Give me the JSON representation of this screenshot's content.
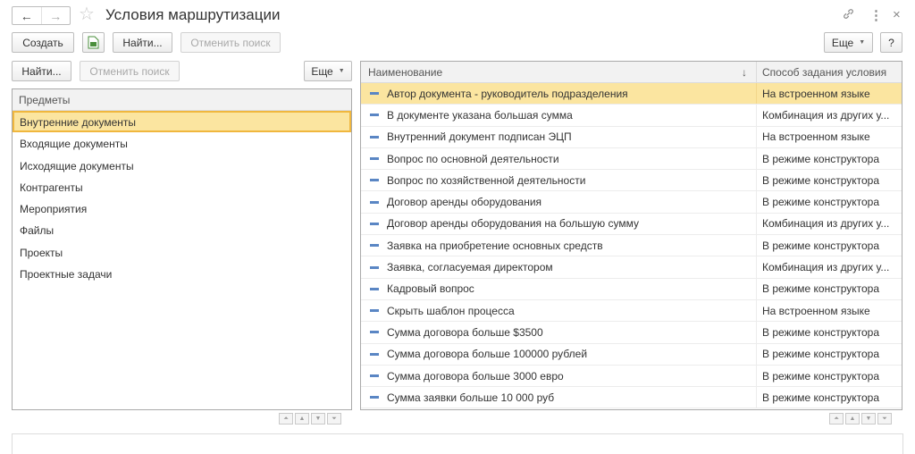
{
  "title": "Условия маршрутизации",
  "nav": {
    "back": "←",
    "forward": "→",
    "star": "☆",
    "link": "🔗",
    "more": "⋮",
    "close": "×"
  },
  "toolbar": {
    "create": "Создать",
    "find": "Найти...",
    "cancel_search": "Отменить поиск",
    "more": "Еще",
    "help": "?"
  },
  "left": {
    "find": "Найти...",
    "cancel_search": "Отменить поиск",
    "more": "Еще",
    "header": "Предметы",
    "items": [
      "Внутренние документы",
      "Входящие документы",
      "Исходящие документы",
      "Контрагенты",
      "Мероприятия",
      "Файлы",
      "Проекты",
      "Проектные задачи"
    ],
    "selected_index": 0
  },
  "table": {
    "columns": {
      "name": "Наименование",
      "method": "Способ задания условия",
      "sort_indicator": "↓"
    },
    "selected_index": 0,
    "rows": [
      {
        "name": "Автор документа - руководитель подразделения",
        "method": "На встроенном языке"
      },
      {
        "name": "В документе указана большая сумма",
        "method": "Комбинация из других у..."
      },
      {
        "name": "Внутренний документ подписан ЭЦП",
        "method": "На встроенном языке"
      },
      {
        "name": "Вопрос по основной деятельности",
        "method": "В режиме конструктора"
      },
      {
        "name": "Вопрос по хозяйственной деятельности",
        "method": "В режиме конструктора"
      },
      {
        "name": "Договор аренды оборудования",
        "method": "В режиме конструктора"
      },
      {
        "name": "Договор аренды оборудования на большую сумму",
        "method": "Комбинация из других у..."
      },
      {
        "name": "Заявка на приобретение основных средств",
        "method": "В режиме конструктора"
      },
      {
        "name": "Заявка, согласуемая директором",
        "method": "Комбинация из других у..."
      },
      {
        "name": "Кадровый вопрос",
        "method": "В режиме конструктора"
      },
      {
        "name": "Скрыть шаблон процесса",
        "method": "На встроенном языке"
      },
      {
        "name": "Сумма договора больше $3500",
        "method": "В режиме конструктора"
      },
      {
        "name": "Сумма договора больше 100000 рублей",
        "method": "В режиме конструктора"
      },
      {
        "name": "Сумма договора больше 3000 евро",
        "method": "В режиме конструктора"
      },
      {
        "name": "Сумма заявки больше 10 000 руб",
        "method": "В режиме конструктора"
      }
    ]
  },
  "colors": {
    "selection": "#fbe5a0",
    "selection_border": "#f0b73e",
    "row_marker": "#5a86c4"
  }
}
